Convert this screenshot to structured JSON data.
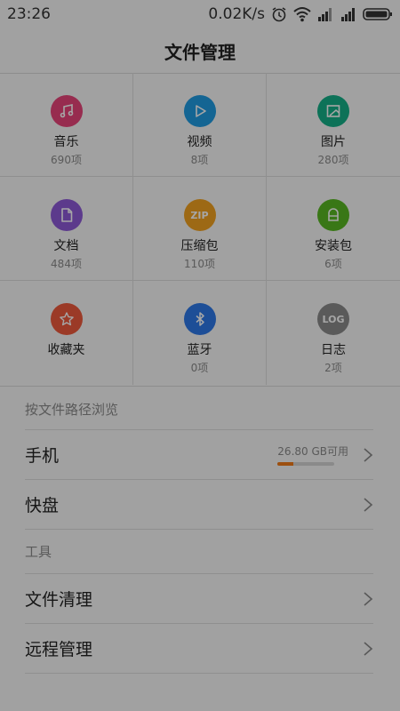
{
  "status": {
    "time": "23:26",
    "speed": "0.02K/s",
    "icons": [
      "alarm-icon",
      "wifi-icon",
      "signal-icon",
      "signal-icon",
      "battery-icon"
    ]
  },
  "title": "文件管理",
  "categories": [
    {
      "label": "音乐",
      "count": "690项",
      "icon": "music-icon",
      "color": "#e8447a"
    },
    {
      "label": "视频",
      "count": "8项",
      "icon": "play-icon",
      "color": "#1f9be2"
    },
    {
      "label": "图片",
      "count": "280项",
      "icon": "image-icon",
      "color": "#14b088"
    },
    {
      "label": "文档",
      "count": "484项",
      "icon": "document-icon",
      "color": "#8e5ad8"
    },
    {
      "label": "压缩包",
      "count": "110项",
      "icon": "zip-icon",
      "glyph": "ZIP",
      "color": "#f2a221"
    },
    {
      "label": "安装包",
      "count": "6项",
      "icon": "apk-icon",
      "color": "#58b722"
    },
    {
      "label": "收藏夹",
      "count": "",
      "icon": "star-icon",
      "color": "#ef5a3c"
    },
    {
      "label": "蓝牙",
      "count": "0项",
      "icon": "bluetooth-icon",
      "color": "#2d78e8"
    },
    {
      "label": "日志",
      "count": "2项",
      "icon": "log-icon",
      "glyph": "LOG",
      "color": "#8a8a8a"
    }
  ],
  "browse": {
    "header": "按文件路径浏览",
    "phone": {
      "label": "手机",
      "storage": "26.80 GB可用",
      "used_fraction": 0.28,
      "accent": "#f07a18"
    },
    "kuaipan": {
      "label": "快盘"
    }
  },
  "tools": {
    "header": "工具",
    "clean": {
      "label": "文件清理"
    },
    "remote": {
      "label": "远程管理"
    }
  }
}
